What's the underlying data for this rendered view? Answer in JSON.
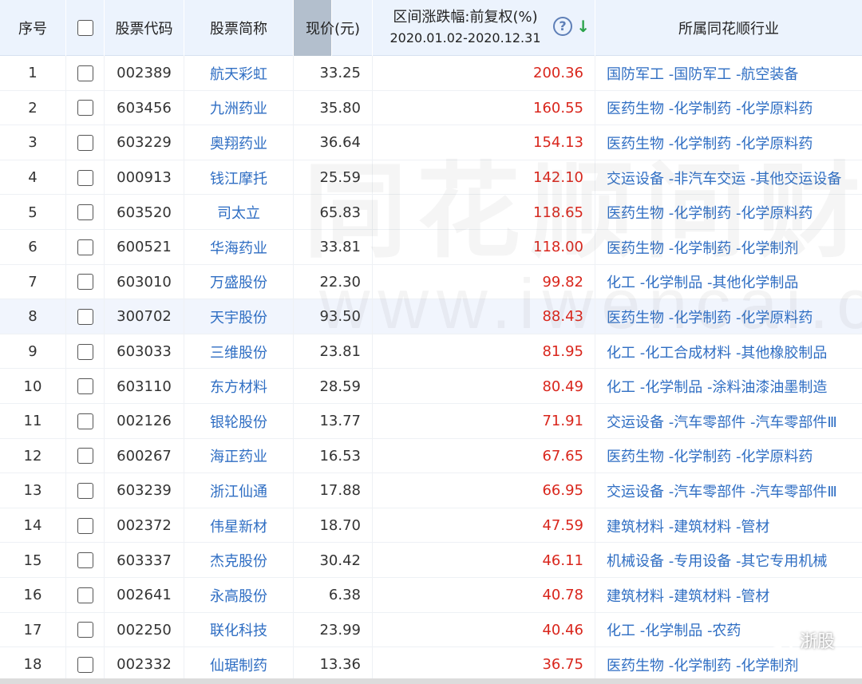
{
  "header": {
    "index": "序号",
    "code": "股票代码",
    "name": "股票简称",
    "price": "现价(元)",
    "range_line1": "区间涨跌幅:前复权(%)",
    "range_line2": "2020.01.02-2020.12.31",
    "help": "?",
    "sort_indicator": "↓",
    "industry": "所属同花顺行业"
  },
  "watermark": {
    "line1": "同花顺问财",
    "line2": "www.iwencai.com"
  },
  "brand": {
    "label": "浙股"
  },
  "colors": {
    "header_bg": "#ecf3fd",
    "link": "#2f6ec3",
    "up": "#d9261c",
    "sort_arrow": "#2aa24a"
  },
  "rows": [
    {
      "idx": "1",
      "code": "002389",
      "name": "航天彩虹",
      "price": "33.25",
      "change": "200.36",
      "industry": "国防军工 -国防军工 -航空装备"
    },
    {
      "idx": "2",
      "code": "603456",
      "name": "九洲药业",
      "price": "35.80",
      "change": "160.55",
      "industry": "医药生物 -化学制药 -化学原料药"
    },
    {
      "idx": "3",
      "code": "603229",
      "name": "奥翔药业",
      "price": "36.64",
      "change": "154.13",
      "industry": "医药生物 -化学制药 -化学原料药"
    },
    {
      "idx": "4",
      "code": "000913",
      "name": "钱江摩托",
      "price": "25.59",
      "change": "142.10",
      "industry": "交运设备 -非汽车交运 -其他交运设备"
    },
    {
      "idx": "5",
      "code": "603520",
      "name": "司太立",
      "price": "65.83",
      "change": "118.65",
      "industry": "医药生物 -化学制药 -化学原料药"
    },
    {
      "idx": "6",
      "code": "600521",
      "name": "华海药业",
      "price": "33.81",
      "change": "118.00",
      "industry": "医药生物 -化学制药 -化学制剂"
    },
    {
      "idx": "7",
      "code": "603010",
      "name": "万盛股份",
      "price": "22.30",
      "change": "99.82",
      "industry": "化工 -化学制品 -其他化学制品"
    },
    {
      "idx": "8",
      "code": "300702",
      "name": "天宇股份",
      "price": "93.50",
      "change": "88.43",
      "industry": "医药生物 -化学制药 -化学原料药"
    },
    {
      "idx": "9",
      "code": "603033",
      "name": "三维股份",
      "price": "23.81",
      "change": "81.95",
      "industry": "化工 -化工合成材料 -其他橡胶制品"
    },
    {
      "idx": "10",
      "code": "603110",
      "name": "东方材料",
      "price": "28.59",
      "change": "80.49",
      "industry": "化工 -化学制品 -涂料油漆油墨制造"
    },
    {
      "idx": "11",
      "code": "002126",
      "name": "银轮股份",
      "price": "13.77",
      "change": "71.91",
      "industry": "交运设备 -汽车零部件 -汽车零部件Ⅲ"
    },
    {
      "idx": "12",
      "code": "600267",
      "name": "海正药业",
      "price": "16.53",
      "change": "67.65",
      "industry": "医药生物 -化学制药 -化学原料药"
    },
    {
      "idx": "13",
      "code": "603239",
      "name": "浙江仙通",
      "price": "17.88",
      "change": "66.95",
      "industry": "交运设备 -汽车零部件 -汽车零部件Ⅲ"
    },
    {
      "idx": "14",
      "code": "002372",
      "name": "伟星新材",
      "price": "18.70",
      "change": "47.59",
      "industry": "建筑材料 -建筑材料 -管材"
    },
    {
      "idx": "15",
      "code": "603337",
      "name": "杰克股份",
      "price": "30.42",
      "change": "46.11",
      "industry": "机械设备 -专用设备 -其它专用机械"
    },
    {
      "idx": "16",
      "code": "002641",
      "name": "永高股份",
      "price": "6.38",
      "change": "40.78",
      "industry": "建筑材料 -建筑材料 -管材"
    },
    {
      "idx": "17",
      "code": "002250",
      "name": "联化科技",
      "price": "23.99",
      "change": "40.46",
      "industry": "化工 -化学制品 -农药"
    },
    {
      "idx": "18",
      "code": "002332",
      "name": "仙琚制药",
      "price": "13.36",
      "change": "36.75",
      "industry": "医药生物 -化学制药 -化学制剂"
    }
  ]
}
